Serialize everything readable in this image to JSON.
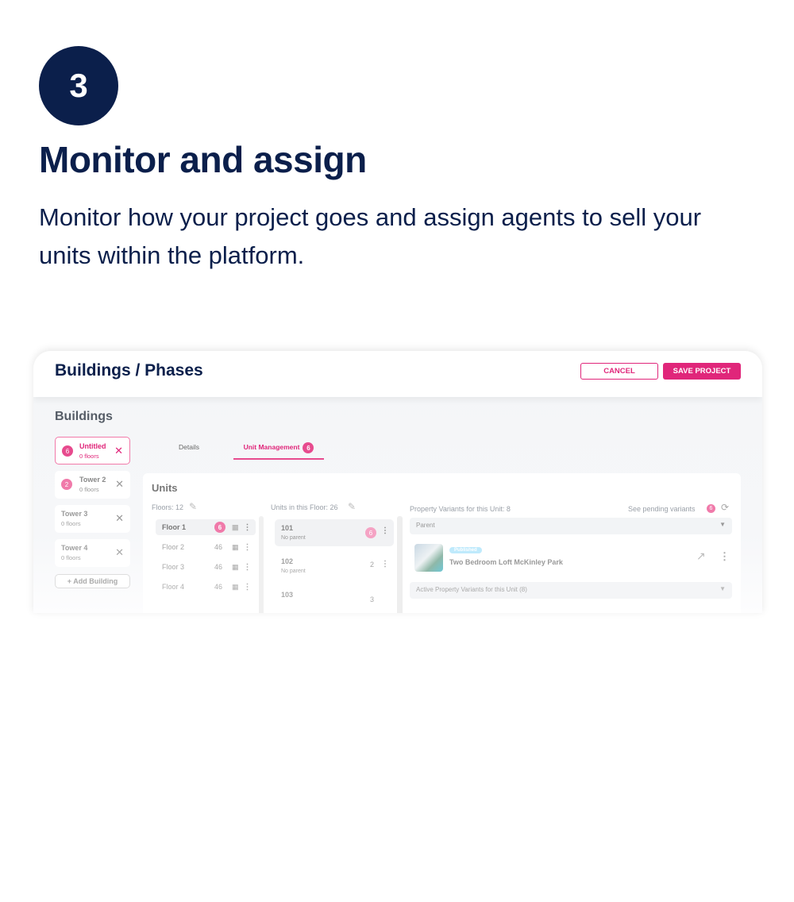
{
  "step": {
    "number": "3",
    "title": "Monitor and assign",
    "description": "Monitor how your project goes and assign agents to sell your units within the platform."
  },
  "app": {
    "header": {
      "title": "Buildings / Phases",
      "cancel": "CANCEL",
      "save": "SAVE PROJECT"
    },
    "sidebar": {
      "heading": "Buildings",
      "items": [
        {
          "badge": "6",
          "name": "Untitled",
          "sub": "0 floors"
        },
        {
          "badge": "2",
          "name": "Tower 2",
          "sub": "0 floors"
        },
        {
          "badge": "",
          "name": "Tower 3",
          "sub": "0 floors"
        },
        {
          "badge": "",
          "name": "Tower 4",
          "sub": "0 floors"
        }
      ],
      "add": "+ Add Building"
    },
    "tabs": [
      {
        "label": "Details"
      },
      {
        "label": "Unit Management",
        "badge": "6"
      }
    ],
    "units": {
      "heading": "Units",
      "floors_label": "Floors: 12",
      "units_label": "Units in this Floor: 26",
      "floors": [
        {
          "name": "Floor 1",
          "count": "6"
        },
        {
          "name": "Floor 2",
          "count": "46"
        },
        {
          "name": "Floor 3",
          "count": "46"
        },
        {
          "name": "Floor 4",
          "count": "46"
        }
      ],
      "unit_list": [
        {
          "name": "101",
          "sub": "No parent",
          "count": "6"
        },
        {
          "name": "102",
          "sub": "No parent",
          "count": "2"
        },
        {
          "name": "103",
          "sub": "",
          "count": "3"
        }
      ],
      "variants_label": "Property Variants for this Unit: 8",
      "pending": "See pending variants",
      "pending_badge": "6",
      "parent_select": "Parent",
      "variant": {
        "status": "Published",
        "name": "Two Bedroom Loft McKinley Park"
      },
      "active_select": "Active Property Variants for this Unit (8)"
    },
    "colors": {
      "accent": "#e0267a",
      "navy": "#0b1f4b"
    }
  }
}
